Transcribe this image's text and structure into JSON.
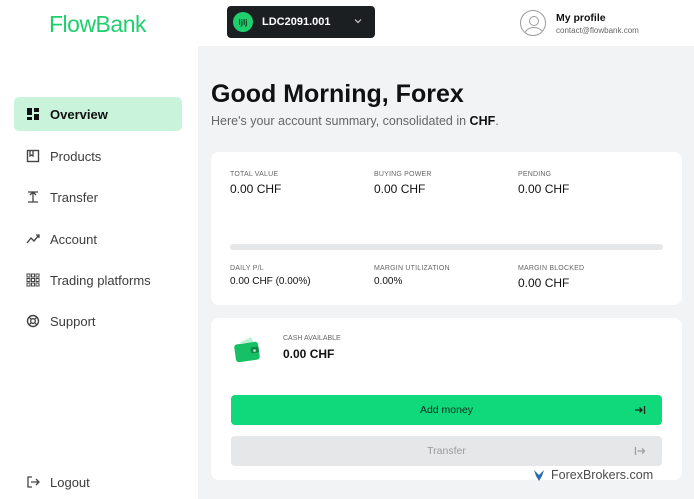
{
  "brand": {
    "logo": "FlowBank",
    "accent": "#1fcf6e"
  },
  "sidebar": {
    "items": [
      {
        "label": "Overview",
        "icon": "dashboard-grid-icon",
        "active": true
      },
      {
        "label": "Products",
        "icon": "bookmark-box-icon"
      },
      {
        "label": "Transfer",
        "icon": "transfer-icon"
      },
      {
        "label": "Account",
        "icon": "trend-line-icon"
      },
      {
        "label": "Trading platforms",
        "icon": "grid-dots-icon"
      },
      {
        "label": "Support",
        "icon": "lifebuoy-icon"
      }
    ],
    "logout": {
      "label": "Logout",
      "icon": "logout-icon"
    }
  },
  "topbar": {
    "account": {
      "badge": "ljlj",
      "id": "LDC2091.001"
    },
    "profile": {
      "name": "My profile",
      "email": "contact@flowbank.com"
    }
  },
  "main": {
    "greeting": "Good Morning, Forex",
    "subtitle_prefix": "Here's your account summary, consolidated in",
    "currency": "CHF",
    "subtitle_suffix": "."
  },
  "summary": {
    "total_value": {
      "label": "TOTAL VALUE",
      "value": "0.00 CHF"
    },
    "buying_power": {
      "label": "BUYING POWER",
      "value": "0.00 CHF"
    },
    "pending": {
      "label": "PENDING",
      "value": "0.00 CHF"
    },
    "daily_pl": {
      "label": "DAILY P/L",
      "value": "0.00 CHF (0.00%)"
    },
    "margin_utilization": {
      "label": "MARGIN UTILIZATION",
      "value": "0.00%"
    },
    "margin_blocked": {
      "label": "MARGIN BLOCKED",
      "value": "0.00 CHF"
    },
    "margin_progress": 0
  },
  "cash": {
    "label": "CASH AVAILABLE",
    "value": "0.00 CHF",
    "add_money": "Add money",
    "transfer": "Transfer"
  },
  "watermark": "ForexBrokers.com"
}
